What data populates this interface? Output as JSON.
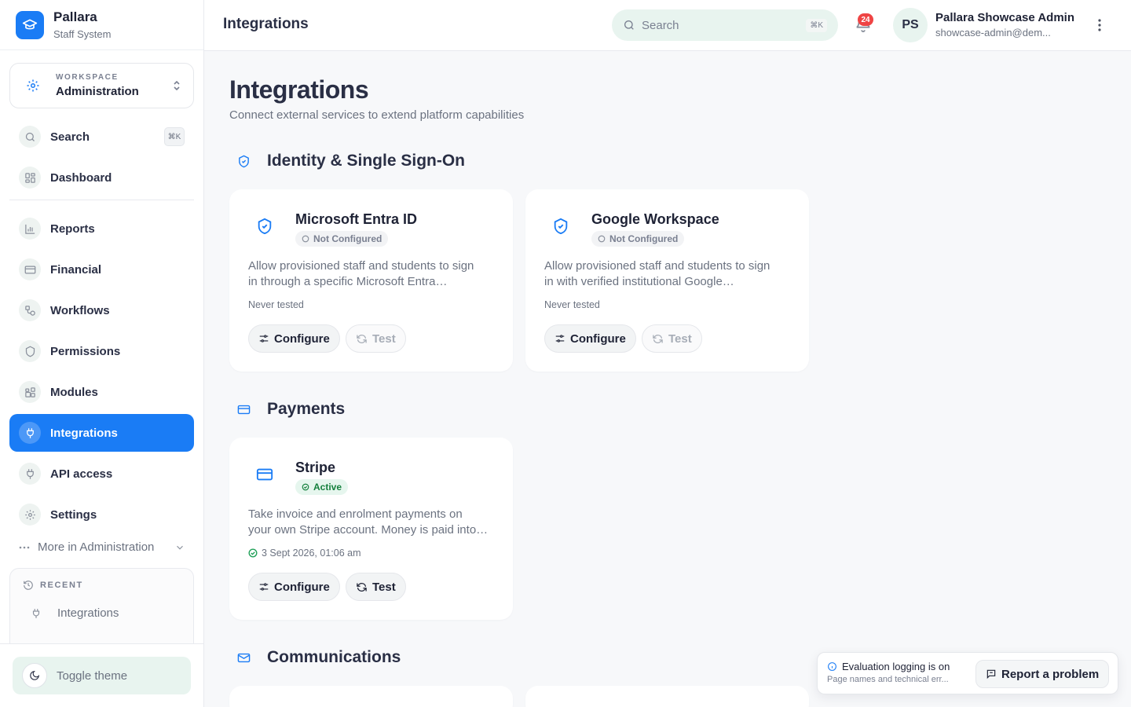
{
  "brand": {
    "name": "Pallara",
    "subtitle": "Staff System"
  },
  "workspace": {
    "label": "WORKSPACE",
    "value": "Administration"
  },
  "sidebar": {
    "search": {
      "label": "Search",
      "shortcut": "⌘K"
    },
    "items": [
      {
        "label": "Dashboard",
        "icon": "dashboard-icon"
      },
      {
        "label": "Reports",
        "icon": "bar-chart-icon"
      },
      {
        "label": "Financial",
        "icon": "credit-card-icon"
      },
      {
        "label": "Workflows",
        "icon": "workflow-icon"
      },
      {
        "label": "Permissions",
        "icon": "shield-icon"
      },
      {
        "label": "Modules",
        "icon": "modules-icon"
      },
      {
        "label": "Integrations",
        "icon": "plug-icon",
        "active": true
      },
      {
        "label": "API access",
        "icon": "plug-icon"
      },
      {
        "label": "Settings",
        "icon": "gear-icon"
      }
    ],
    "more": "More in Administration",
    "recent": {
      "label": "RECENT",
      "items": [
        "Integrations"
      ]
    },
    "toggle_theme": "Toggle theme"
  },
  "topbar": {
    "title": "Integrations",
    "search_placeholder": "Search",
    "search_shortcut": "⌘K",
    "notifications_count": "24",
    "user": {
      "initials": "PS",
      "name": "Pallara Showcase Admin",
      "email": "showcase-admin@dem..."
    }
  },
  "page": {
    "title": "Integrations",
    "subtitle": "Connect external services to extend platform capabilities"
  },
  "sections": [
    {
      "title": "Identity & Single Sign-On",
      "icon": "shield-check-icon",
      "cards": [
        {
          "name": "Microsoft Entra ID",
          "status": "Not Configured",
          "desc1": "Allow provisioned staff and students to sign",
          "desc2": "in through a specific Microsoft Entra…",
          "tested": "Never tested",
          "configure": "Configure",
          "test": "Test"
        },
        {
          "name": "Google Workspace",
          "status": "Not Configured",
          "desc1": "Allow provisioned staff and students to sign",
          "desc2": "in with verified institutional Google…",
          "tested": "Never tested",
          "configure": "Configure",
          "test": "Test"
        }
      ]
    },
    {
      "title": "Payments",
      "icon": "credit-card-icon",
      "cards": [
        {
          "name": "Stripe",
          "status": "Active",
          "desc1": "Take invoice and enrolment payments on",
          "desc2": "your own Stripe account. Money is paid into…",
          "tested": "3 Sept 2026, 01:06 am",
          "configure": "Configure",
          "test": "Test"
        }
      ]
    },
    {
      "title": "Communications",
      "icon": "mail-icon",
      "cards": []
    }
  ],
  "toast": {
    "title": "Evaluation logging is on",
    "subtitle": "Page names and technical err...",
    "button": "Report a problem"
  },
  "colors": {
    "accent": "#1a7cf5",
    "active_green": "#15803d",
    "badge_red": "#ef4444",
    "mint": "#e8f4ef"
  }
}
